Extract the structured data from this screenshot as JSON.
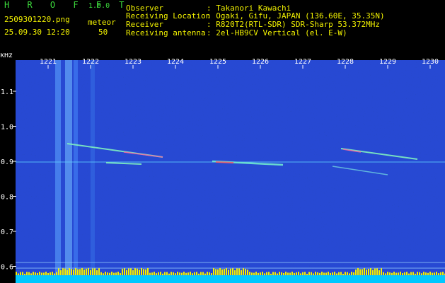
{
  "app": {
    "name": "H R O F F T",
    "version": "1.0.0"
  },
  "image": {
    "filename": "2509301220.png",
    "datetime": "25.09.30 12:20"
  },
  "meteor": {
    "label": "meteor",
    "count": "50"
  },
  "info": {
    "labels": [
      "Observer",
      "Receiving Location",
      "Receiver",
      "Receiving antenna"
    ],
    "values": [
      ": Takanori Kawachi",
      ": Ogaki, Gifu, JAPAN (136.60E, 35.35N)",
      ": R820T2(RTL-SDR) SDR-Sharp 53.372MHz",
      ": 2el-HB9CV Vertical (el. E-W)"
    ]
  },
  "axis": {
    "unit": "kHz",
    "time_ticks": [
      "1221",
      "1222",
      "1223",
      "1224",
      "1225",
      "1226",
      "1227",
      "1228",
      "1229",
      "1230"
    ],
    "freq_ticks": [
      "1.1",
      "1.0",
      "0.9",
      "0.8",
      "0.7",
      "0.6"
    ]
  },
  "colors": {
    "green_text": "#3ddc3d",
    "yellow_text": "#f2f200",
    "background": "#000000",
    "noise": "#0b1f9e"
  }
}
